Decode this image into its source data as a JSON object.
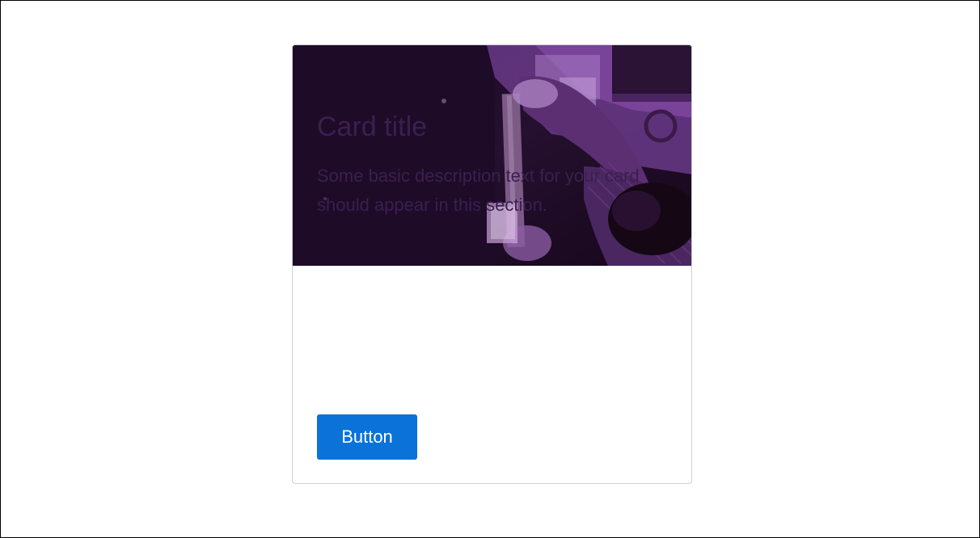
{
  "card": {
    "image_description_icon": "photo-icon",
    "title": "Card title",
    "description": "Some basic description text for your card should appear in this section.",
    "button_label": "Button"
  },
  "colors": {
    "title_text": "#3b1f4f",
    "body_text": "#3b1f4f",
    "button_bg": "#0a72d8",
    "button_text": "#ffffff",
    "image_tint": "#5c2a78"
  }
}
